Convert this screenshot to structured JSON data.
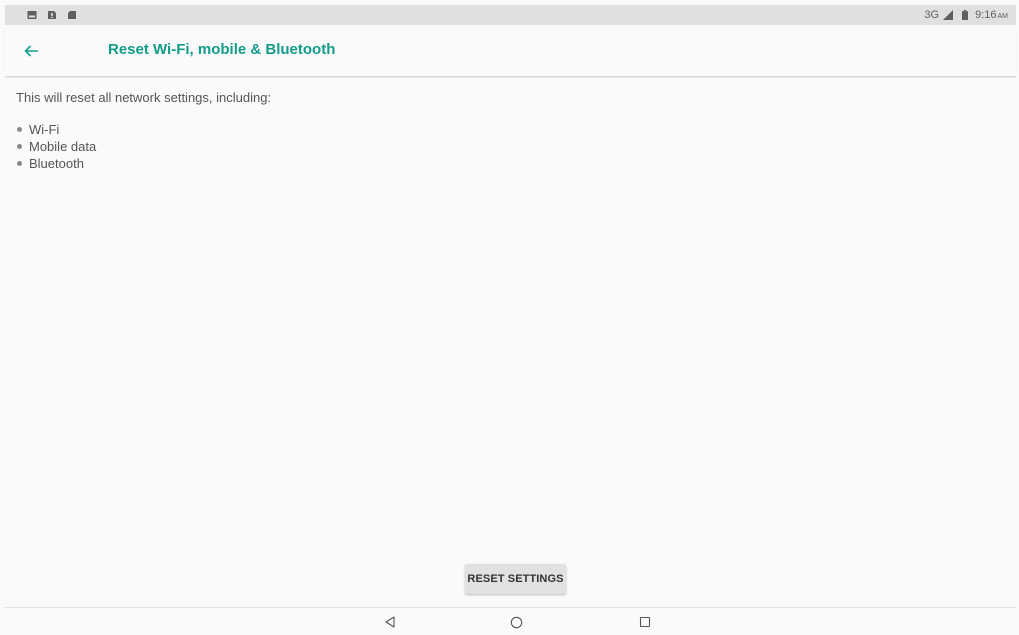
{
  "status_bar": {
    "network_type": "3G",
    "time": "9:16",
    "time_suffix": "AM",
    "icons": [
      "image-notification-icon",
      "sim-notification-icon",
      "sd-card-notification-icon",
      "signal-icon",
      "battery-icon"
    ]
  },
  "app_bar": {
    "title": "Reset Wi-Fi, mobile & Bluetooth",
    "back_icon": "arrow-back-icon",
    "title_color": "#139c8a"
  },
  "content": {
    "intro": "This will reset all network settings, including:",
    "items": [
      {
        "label": "Wi‑Fi"
      },
      {
        "label": "Mobile data"
      },
      {
        "label": "Bluetooth"
      }
    ]
  },
  "reset_button": {
    "label": "RESET SETTINGS"
  },
  "nav_bar": {
    "icons": [
      "nav-back-icon",
      "nav-home-icon",
      "nav-recents-icon"
    ]
  }
}
